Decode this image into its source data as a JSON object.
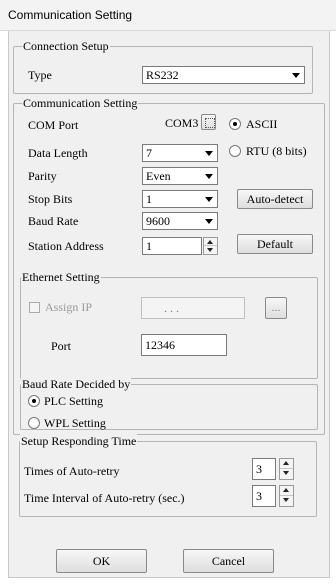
{
  "window": {
    "title": "Communication Setting"
  },
  "connection_setup": {
    "legend": "Connection Setup",
    "type_label": "Type",
    "type_value": "RS232"
  },
  "communication_setting": {
    "legend": "Communication Setting",
    "com_port_label": "COM Port",
    "com_port_value": "COM3",
    "radio_ascii": "ASCII",
    "radio_rtu": "RTU (8 bits)",
    "data_length_label": "Data Length",
    "data_length_value": "7",
    "parity_label": "Parity",
    "parity_value": "Even",
    "stop_bits_label": "Stop Bits",
    "stop_bits_value": "1",
    "auto_detect": "Auto-detect",
    "baud_rate_label": "Baud Rate",
    "baud_rate_value": "9600",
    "station_address_label": "Station Address",
    "station_address_value": "1",
    "default_button": "Default"
  },
  "ethernet_setting": {
    "legend": "Ethernet Setting",
    "assign_ip_label": "Assign IP",
    "ip_value": ". . .",
    "browse_button": "...",
    "port_label": "Port",
    "port_value": "12346"
  },
  "baud_rate_decided": {
    "legend": "Baud Rate Decided by",
    "plc_setting": "PLC Setting",
    "wpl_setting": "WPL Setting"
  },
  "responding_time": {
    "legend": "Setup Responding Time",
    "retry_label": "Times of Auto-retry",
    "retry_value": "3",
    "interval_label": "Time Interval of Auto-retry (sec.)",
    "interval_value": "3"
  },
  "buttons": {
    "ok": "OK",
    "cancel": "Cancel"
  }
}
